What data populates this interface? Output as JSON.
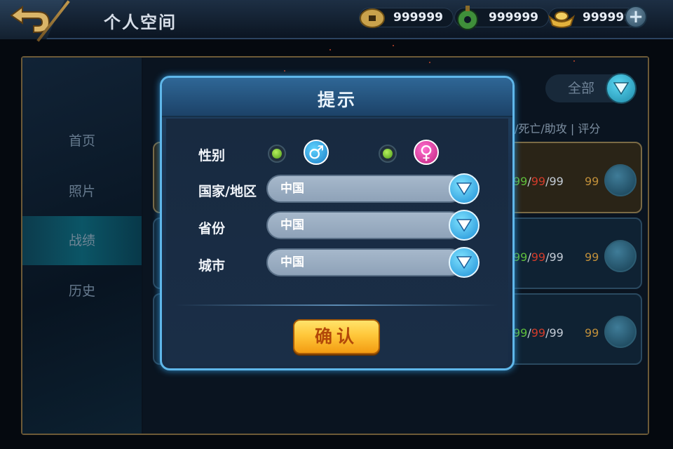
{
  "header": {
    "title": "个人空间",
    "currencies": [
      {
        "icon": "coin-icon",
        "value": "999999"
      },
      {
        "icon": "jade-icon",
        "value": "999999"
      },
      {
        "icon": "gold-ingot-icon",
        "value": "999999"
      }
    ],
    "plus_label": "+"
  },
  "sidebar": {
    "items": [
      {
        "label": "首页"
      },
      {
        "label": "照片"
      },
      {
        "label": "战绩",
        "active": true
      },
      {
        "label": "历史"
      }
    ]
  },
  "records": {
    "filter_label": "全部",
    "columns_header": "杀/死亡/助攻 | 评分",
    "rows": [
      {
        "kda": [
          "99",
          "99",
          "99"
        ],
        "score": "99"
      },
      {
        "kda": [
          "99",
          "99",
          "99"
        ],
        "score": "99"
      },
      {
        "kda": [
          "99",
          "99",
          "99"
        ],
        "score": "99"
      }
    ]
  },
  "dialog": {
    "title": "提示",
    "gender_label": "性别",
    "male_symbol": "♂",
    "female_symbol": "♀",
    "country_label": "国家/地区",
    "country_value": "中国",
    "province_label": "省份",
    "province_value": "中国",
    "city_label": "城市",
    "city_value": "中国",
    "confirm_label": "确认"
  },
  "colors": {
    "dialog_border": "#5fb7ea",
    "confirm_bg": "#ffc73a",
    "male": "#1c7ec6",
    "female": "#c0227e"
  }
}
